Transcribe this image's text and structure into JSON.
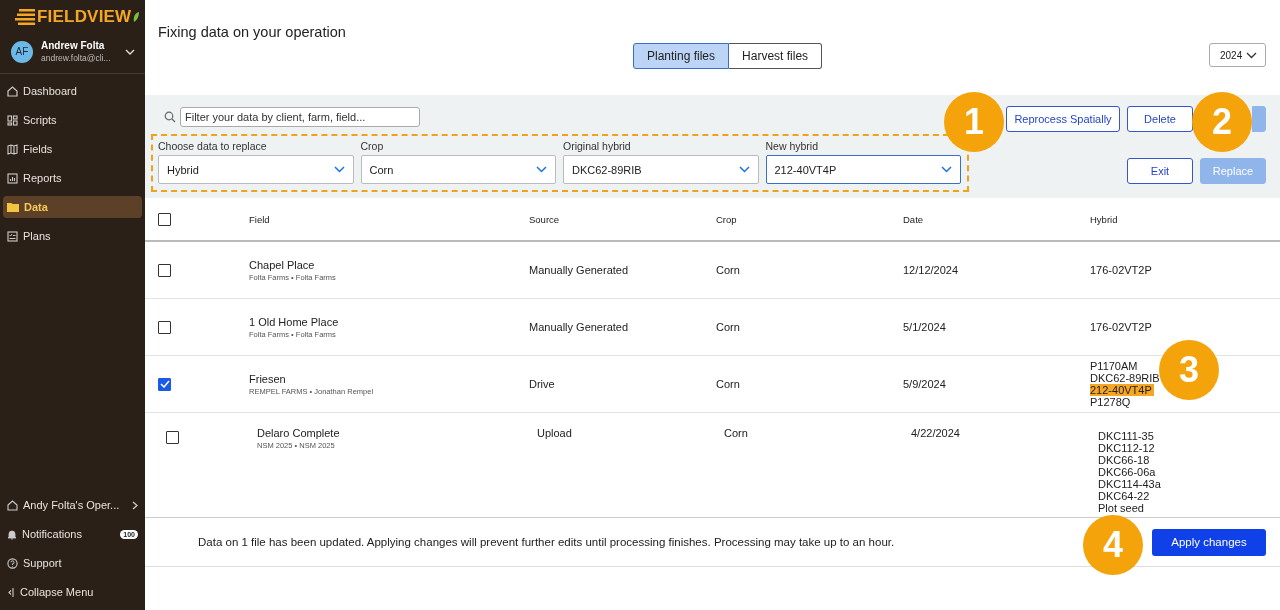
{
  "sidebar": {
    "logo": "FIELDVIEW",
    "user": {
      "initials": "AF",
      "name": "Andrew Folta",
      "email": "andrew.folta@cli..."
    },
    "items": [
      {
        "label": "Dashboard",
        "selected": false
      },
      {
        "label": "Scripts",
        "selected": false
      },
      {
        "label": "Fields",
        "selected": false
      },
      {
        "label": "Reports",
        "selected": false
      },
      {
        "label": "Data",
        "selected": true
      },
      {
        "label": "Plans",
        "selected": false
      }
    ],
    "operation": "Andy Folta's Oper...",
    "notifications": {
      "label": "Notifications",
      "badge": "100"
    },
    "support": "Support",
    "collapse": "Collapse Menu"
  },
  "page": {
    "title": "Fixing data on your operation",
    "tabs": [
      {
        "label": "Planting files",
        "selected": true
      },
      {
        "label": "Harvest files",
        "selected": false
      }
    ],
    "year": "2024"
  },
  "toolbar": {
    "search": {
      "placeholder": "Filter your data by client, farm, field..."
    },
    "dropdowns": [
      {
        "label": "Choose data to replace",
        "value": "Hybrid",
        "focused": false
      },
      {
        "label": "Crop",
        "value": "Corn",
        "focused": false
      },
      {
        "label": "Original hybrid",
        "value": "DKC62-89RIB",
        "focused": false
      },
      {
        "label": "New hybrid",
        "value": "212-40VT4P",
        "focused": true
      }
    ],
    "buttons": [
      {
        "label": "Reprocess Spatially",
        "disabled": false
      },
      {
        "label": "Delete",
        "disabled": false
      },
      {
        "disabled": true
      },
      {
        "label": "Exit",
        "disabled": false
      },
      {
        "label": "Replace",
        "disabled": true
      }
    ]
  },
  "table": {
    "select_all": {
      "checked": false
    },
    "columns": [
      "Field",
      "Source",
      "Crop",
      "Date",
      "Hybrid"
    ],
    "rows": [
      {
        "checked": false,
        "field": "Chapel Place",
        "sub": "Folta Farms • Folta Farms",
        "source": "Manually Generated",
        "crop": "Corn",
        "date": "12/12/2024",
        "hybrids": [
          {
            "text": "176-02VT2P",
            "highlighted": false
          }
        ]
      },
      {
        "checked": false,
        "field": "1 Old Home Place",
        "sub": "Folta Farms • Folta Farms",
        "source": "Manually Generated",
        "crop": "Corn",
        "date": "5/1/2024",
        "hybrids": [
          {
            "text": "176-02VT2P",
            "highlighted": false
          }
        ]
      },
      {
        "checked": true,
        "field": "Friesen",
        "sub": "REMPEL FARMS • Jonathan Rempel",
        "source": "Drive",
        "crop": "Corn",
        "date": "5/9/2024",
        "hybrids": [
          {
            "text": "P1170AM",
            "highlighted": false
          },
          {
            "text": "DKC62-89RIB",
            "highlighted": false
          },
          {
            "text": "212-40VT4P",
            "highlighted": true
          },
          {
            "text": "P1278Q",
            "highlighted": false
          }
        ]
      },
      {
        "checked": false,
        "field": "Delaro Complete",
        "sub": "NSM 2025 • NSM 2025",
        "source": "Upload",
        "crop": "Corn",
        "date": "4/22/2024",
        "hybrids": [
          {
            "text": "DKC111-35",
            "highlighted": false
          },
          {
            "text": "DKC112-12",
            "highlighted": false
          },
          {
            "text": "DKC66-18",
            "highlighted": false
          },
          {
            "text": "DKC66-06a",
            "highlighted": false
          },
          {
            "text": "DKC114-43a",
            "highlighted": false
          },
          {
            "text": "DKC64-22",
            "highlighted": false
          },
          {
            "text": "Plot seed",
            "highlighted": false
          }
        ]
      }
    ]
  },
  "footer": {
    "message": "Data on 1 file has been updated. Applying changes will prevent further edits until processing finishes. Processing may take up to an hour.",
    "button": "Apply changes"
  },
  "callouts": [
    "1",
    "2",
    "3",
    "4"
  ]
}
